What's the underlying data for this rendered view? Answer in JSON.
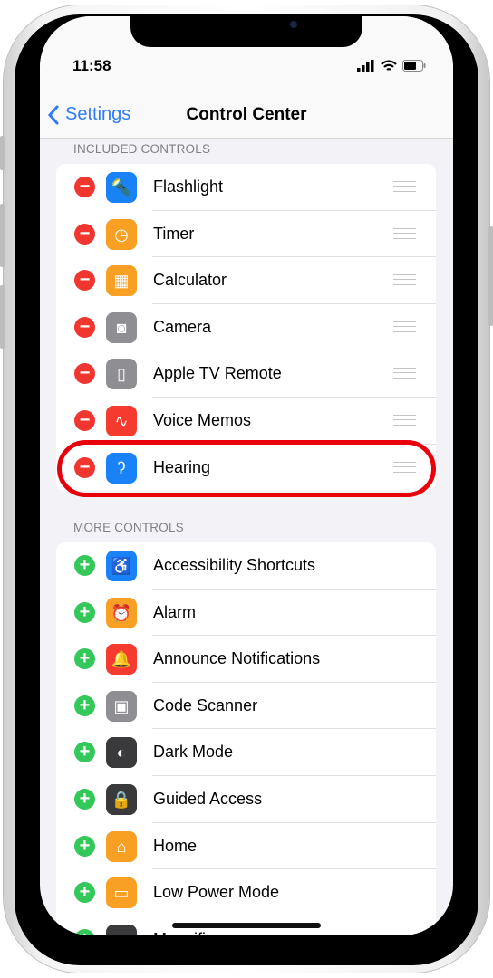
{
  "status": {
    "time": "11:58"
  },
  "nav": {
    "back_label": "Settings",
    "title": "Control Center"
  },
  "included": {
    "header": "INCLUDED CONTROLS",
    "items": [
      {
        "label": "Flashlight",
        "icon": "flashlight-icon",
        "color": "#1a82f7",
        "glyph": "🔦"
      },
      {
        "label": "Timer",
        "icon": "timer-icon",
        "color": "#f7a024",
        "glyph": "◷"
      },
      {
        "label": "Calculator",
        "icon": "calculator-icon",
        "color": "#f7a024",
        "glyph": "▦"
      },
      {
        "label": "Camera",
        "icon": "camera-icon",
        "color": "#8e8e93",
        "glyph": "◙"
      },
      {
        "label": "Apple TV Remote",
        "icon": "remote-icon",
        "color": "#8e8e93",
        "glyph": "▯"
      },
      {
        "label": "Voice Memos",
        "icon": "waveform-icon",
        "color": "#f53b30",
        "glyph": "∿"
      },
      {
        "label": "Hearing",
        "icon": "ear-icon",
        "color": "#1a82f7",
        "glyph": "ʔ"
      }
    ]
  },
  "more": {
    "header": "MORE CONTROLS",
    "items": [
      {
        "label": "Accessibility Shortcuts",
        "icon": "accessibility-icon",
        "color": "#1a82f7",
        "glyph": "♿"
      },
      {
        "label": "Alarm",
        "icon": "alarm-icon",
        "color": "#f7a024",
        "glyph": "⏰"
      },
      {
        "label": "Announce Notifications",
        "icon": "bell-icon",
        "color": "#f53b30",
        "glyph": "🔔"
      },
      {
        "label": "Code Scanner",
        "icon": "qr-code-icon",
        "color": "#8e8e93",
        "glyph": "▣"
      },
      {
        "label": "Dark Mode",
        "icon": "dark-mode-icon",
        "color": "#3a3a3c",
        "glyph": "◐"
      },
      {
        "label": "Guided Access",
        "icon": "lock-icon",
        "color": "#3a3a3c",
        "glyph": "🔒"
      },
      {
        "label": "Home",
        "icon": "home-icon",
        "color": "#f7a024",
        "glyph": "⌂"
      },
      {
        "label": "Low Power Mode",
        "icon": "battery-icon",
        "color": "#f7a024",
        "glyph": "▭"
      },
      {
        "label": "Magnifier",
        "icon": "magnifier-icon",
        "color": "#3a3a3c",
        "glyph": "⊕"
      }
    ]
  },
  "highlight_color": "#e8000b"
}
